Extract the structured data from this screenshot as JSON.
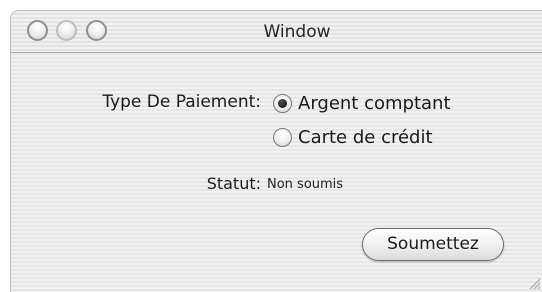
{
  "window": {
    "title": "Window"
  },
  "form": {
    "payment_type_label": "Type De Paiement:",
    "options": [
      {
        "label": "Argent comptant",
        "selected": true
      },
      {
        "label": "Carte de crédit",
        "selected": false
      }
    ],
    "status_label": "Statut:",
    "status_value": "Non soumis",
    "submit_label": "Soumettez"
  },
  "icons": {
    "close": "close-icon",
    "minimize": "minimize-icon",
    "zoom": "zoom-icon",
    "resize": "resize-grip-icon"
  }
}
